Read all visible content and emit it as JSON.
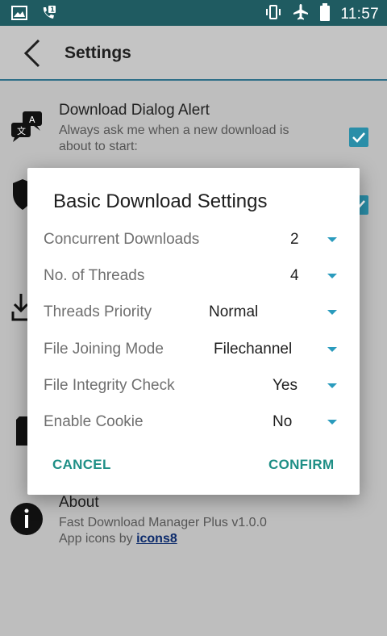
{
  "status_bar": {
    "time": "11:57",
    "icons": [
      "image-icon",
      "missed-call-icon",
      "vibrate-icon",
      "airplane-icon",
      "battery-icon"
    ]
  },
  "app_bar": {
    "title": "Settings",
    "back_icon": "chevron-left-icon"
  },
  "settings": {
    "download_dialog_alert": {
      "title": "Download Dialog Alert",
      "subtitle": "Always ask me when a new download is about to start:",
      "checked": true
    },
    "about": {
      "title": "About",
      "version_line": "Fast Download Manager Plus v1.0.0",
      "icons_prefix": "App icons by ",
      "icons_link": "icons8"
    }
  },
  "dialog": {
    "title": "Basic Download Settings",
    "rows": [
      {
        "label": "Concurrent Downloads",
        "value": "2"
      },
      {
        "label": "No. of Threads",
        "value": "4"
      },
      {
        "label": "Threads Priority",
        "value": "Normal"
      },
      {
        "label": "File Joining Mode",
        "value": "Filechannel"
      },
      {
        "label": "File Integrity Check",
        "value": "Yes"
      },
      {
        "label": "Enable Cookie",
        "value": "No"
      }
    ],
    "cancel_label": "CANCEL",
    "confirm_label": "CONFIRM"
  },
  "colors": {
    "status_bar": "#1f5b61",
    "accent": "#1f8f86",
    "caret": "#2a9bbd",
    "checkbox": "#2a8ea8"
  }
}
